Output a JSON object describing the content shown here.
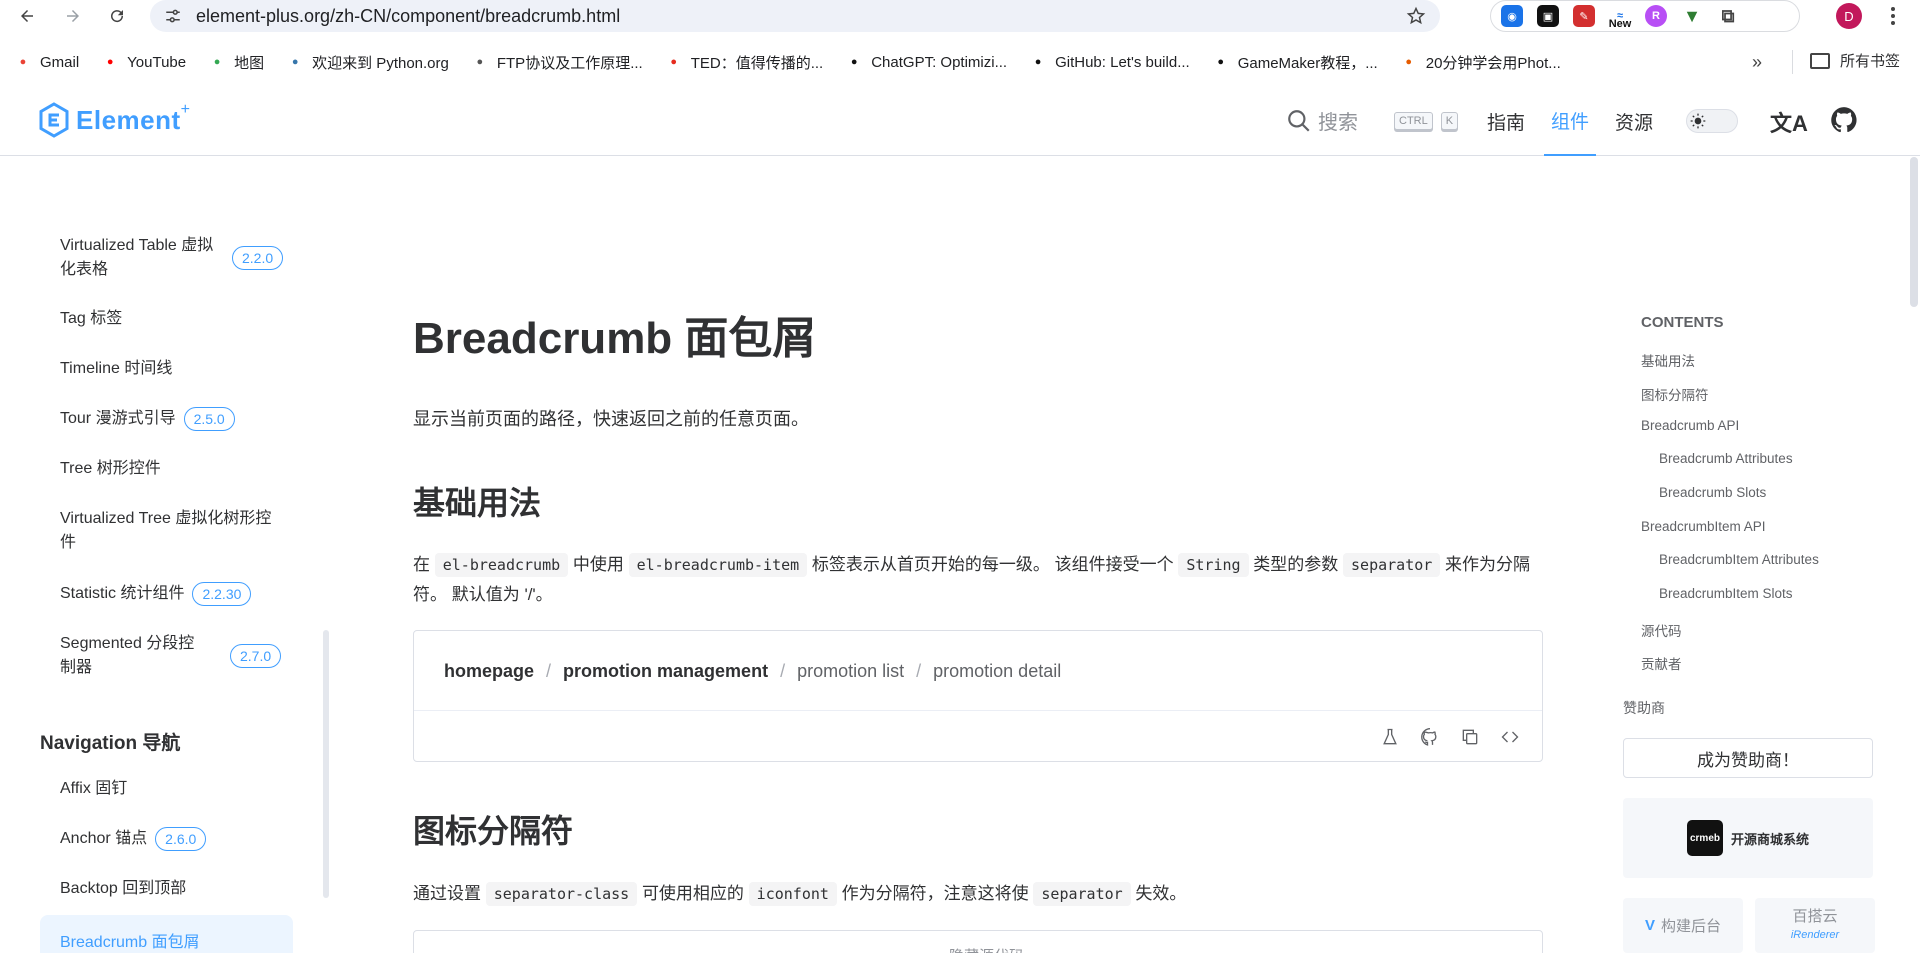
{
  "browser": {
    "url": "element-plus.org/zh-CN/component/breadcrumb.html",
    "ext_new_label": "New",
    "profile_initial": "D"
  },
  "bookmarks": {
    "items": [
      {
        "label": "Gmail",
        "icon": "gmail-icon",
        "color": "#ea4335"
      },
      {
        "label": "YouTube",
        "icon": "youtube-icon",
        "color": "#ff0000"
      },
      {
        "label": "地图",
        "icon": "maps-icon",
        "color": "#34a853"
      },
      {
        "label": "欢迎来到 Python.org",
        "icon": "python-icon",
        "color": "#3776ab"
      },
      {
        "label": "FTP协议及工作原理...",
        "icon": "ftp-icon",
        "color": "#555555"
      },
      {
        "label": "TED：值得传播的...",
        "icon": "ted-icon",
        "color": "#e62b1e"
      },
      {
        "label": "ChatGPT: Optimizi...",
        "icon": "chatgpt-icon",
        "color": "#111111"
      },
      {
        "label": "GitHub: Let's build...",
        "icon": "github-icon",
        "color": "#111111"
      },
      {
        "label": "GameMaker教程，...",
        "icon": "gamemaker-icon",
        "color": "#111111"
      },
      {
        "label": "20分钟学会用Phot...",
        "icon": "photoshop-icon",
        "color": "#e65c00"
      }
    ],
    "more_glyph": "»",
    "all_label": "所有书签"
  },
  "header": {
    "logo_text": "Element",
    "logo_plus": "+",
    "search_label": "搜索",
    "kbd_ctrl": "CTRL",
    "kbd_k": "K",
    "nav": [
      {
        "label": "指南",
        "active": false
      },
      {
        "label": "组件",
        "active": true
      },
      {
        "label": "资源",
        "active": false
      }
    ],
    "lang_glyph": "文A"
  },
  "sidebar": {
    "items": [
      {
        "label": "Virtualized Table 虚拟化表格",
        "badge": "2.2.0"
      },
      {
        "label": "Tag 标签",
        "badge": ""
      },
      {
        "label": "Timeline 时间线",
        "badge": ""
      },
      {
        "label": "Tour 漫游式引导",
        "badge": "2.5.0"
      },
      {
        "label": "Tree 树形控件",
        "badge": ""
      },
      {
        "label": "Virtualized Tree 虚拟化树形控件",
        "badge": ""
      },
      {
        "label": "Statistic 统计组件",
        "badge": "2.2.30"
      },
      {
        "label": "Segmented 分段控制器",
        "badge": "2.7.0"
      }
    ],
    "group": "Navigation 导航",
    "nav_items": [
      {
        "label": "Affix 固钉",
        "badge": ""
      },
      {
        "label": "Anchor 锚点",
        "badge": "2.6.0"
      },
      {
        "label": "Backtop 回到顶部",
        "badge": ""
      }
    ],
    "active_item": "Breadcrumb 面包屑"
  },
  "main": {
    "title": "Breadcrumb 面包屑",
    "lead": "显示当前页面的路径，快速返回之前的任意页面。",
    "section1": {
      "heading": "基础用法",
      "p_prefix": "在",
      "code1": "el-breadcrumb",
      "p_mid1": "中使用",
      "code2": "el-breadcrumb-item",
      "p_mid2": "标签表示从首页开始的每一级。 该组件接受一个",
      "code3": "String",
      "p_mid3": "类型的参数",
      "code4": "separator",
      "p_mid4": "来作为分隔符。 默认值为 '/'。"
    },
    "demo": {
      "crumbs": [
        {
          "label": "homepage",
          "strong": true
        },
        {
          "label": "promotion management",
          "strong": true
        },
        {
          "label": "promotion list",
          "strong": false
        },
        {
          "label": "promotion detail",
          "strong": false
        }
      ],
      "separator": "/",
      "hidden_code_label": "隐藏源代码"
    },
    "section2": {
      "heading": "图标分隔符",
      "p_prefix": "通过设置",
      "code1": "separator-class",
      "p_mid1": "可使用相应的",
      "code2": "iconfont",
      "p_mid2": "作为分隔符，注意这将使",
      "code3": "separator",
      "p_mid3": "失效。"
    }
  },
  "toc": {
    "title": "CONTENTS",
    "items": [
      {
        "label": "基础用法",
        "indent": false
      },
      {
        "label": "图标分隔符",
        "indent": false
      },
      {
        "label": "Breadcrumb API",
        "indent": false
      },
      {
        "label": "Breadcrumb Attributes",
        "indent": true
      },
      {
        "label": "Breadcrumb Slots",
        "indent": true
      },
      {
        "label": "BreadcrumbItem API",
        "indent": false
      },
      {
        "label": "BreadcrumbItem Attributes",
        "indent": true
      },
      {
        "label": "BreadcrumbItem Slots",
        "indent": true
      },
      {
        "label": "源代码",
        "indent": false
      },
      {
        "label": "贡献者",
        "indent": false
      }
    ],
    "sponsor_label": "赞助商",
    "sponsor_button": "成为赞助商！",
    "sponsor_card": "开源商城系统",
    "sponsor_logo_text": "crmeb",
    "sponsor_mini1": "构建后台",
    "sponsor_mini2": "百搭云",
    "sponsor_mini2_sub": "iRenderer"
  },
  "colors": {
    "accent": "#409eff",
    "text": "#303133",
    "border": "#dcdfe6"
  }
}
